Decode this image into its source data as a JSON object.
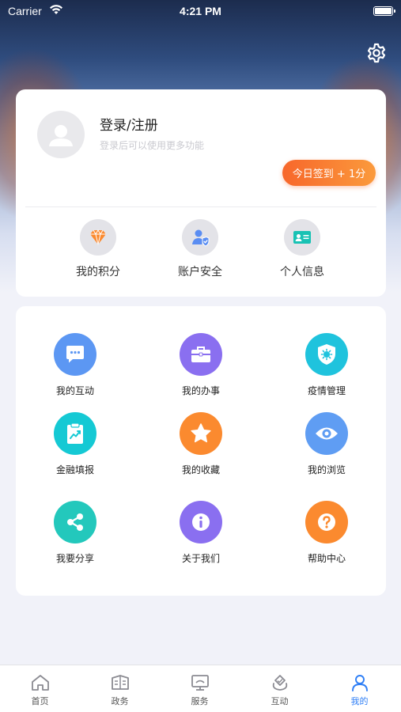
{
  "status_bar": {
    "carrier": "Carrier",
    "time": "4:21 PM"
  },
  "profile": {
    "login_title": "登录/注册",
    "login_subtitle": "登录后可以使用更多功能",
    "checkin_label": "今日签到 + 1分"
  },
  "quick_actions": [
    {
      "label": "我的积分",
      "icon": "diamond-icon"
    },
    {
      "label": "账户安全",
      "icon": "user-shield-icon"
    },
    {
      "label": "个人信息",
      "icon": "id-card-icon"
    }
  ],
  "functions": [
    {
      "label": "我的互动",
      "icon": "chat-bubble-icon",
      "color": "#5c97f3"
    },
    {
      "label": "我的办事",
      "icon": "briefcase-icon",
      "color": "#8a6ff0"
    },
    {
      "label": "疫情管理",
      "icon": "shield-virus-icon",
      "color": "#1fc3dd"
    },
    {
      "label": "金融填报",
      "icon": "clipboard-chart-icon",
      "color": "#15c9d4"
    },
    {
      "label": "我的收藏",
      "icon": "star-icon",
      "color": "#fb8a2f"
    },
    {
      "label": "我的浏览",
      "icon": "eye-icon",
      "color": "#5f9df3"
    },
    {
      "label": "我要分享",
      "icon": "share-icon",
      "color": "#23c8bc"
    },
    {
      "label": "关于我们",
      "icon": "info-icon",
      "color": "#8a6ff0"
    },
    {
      "label": "帮助中心",
      "icon": "question-icon",
      "color": "#fb8a2f"
    }
  ],
  "tabs": [
    {
      "label": "首页",
      "icon": "home-icon",
      "active": false
    },
    {
      "label": "政务",
      "icon": "government-icon",
      "active": false
    },
    {
      "label": "服务",
      "icon": "service-icon",
      "active": false
    },
    {
      "label": "互动",
      "icon": "interaction-icon",
      "active": false
    },
    {
      "label": "我的",
      "icon": "user-icon",
      "active": true
    }
  ],
  "colors": {
    "accent": "#2f7ff6",
    "checkin_start": "#f7672b",
    "checkin_end": "#fb9a3c"
  }
}
